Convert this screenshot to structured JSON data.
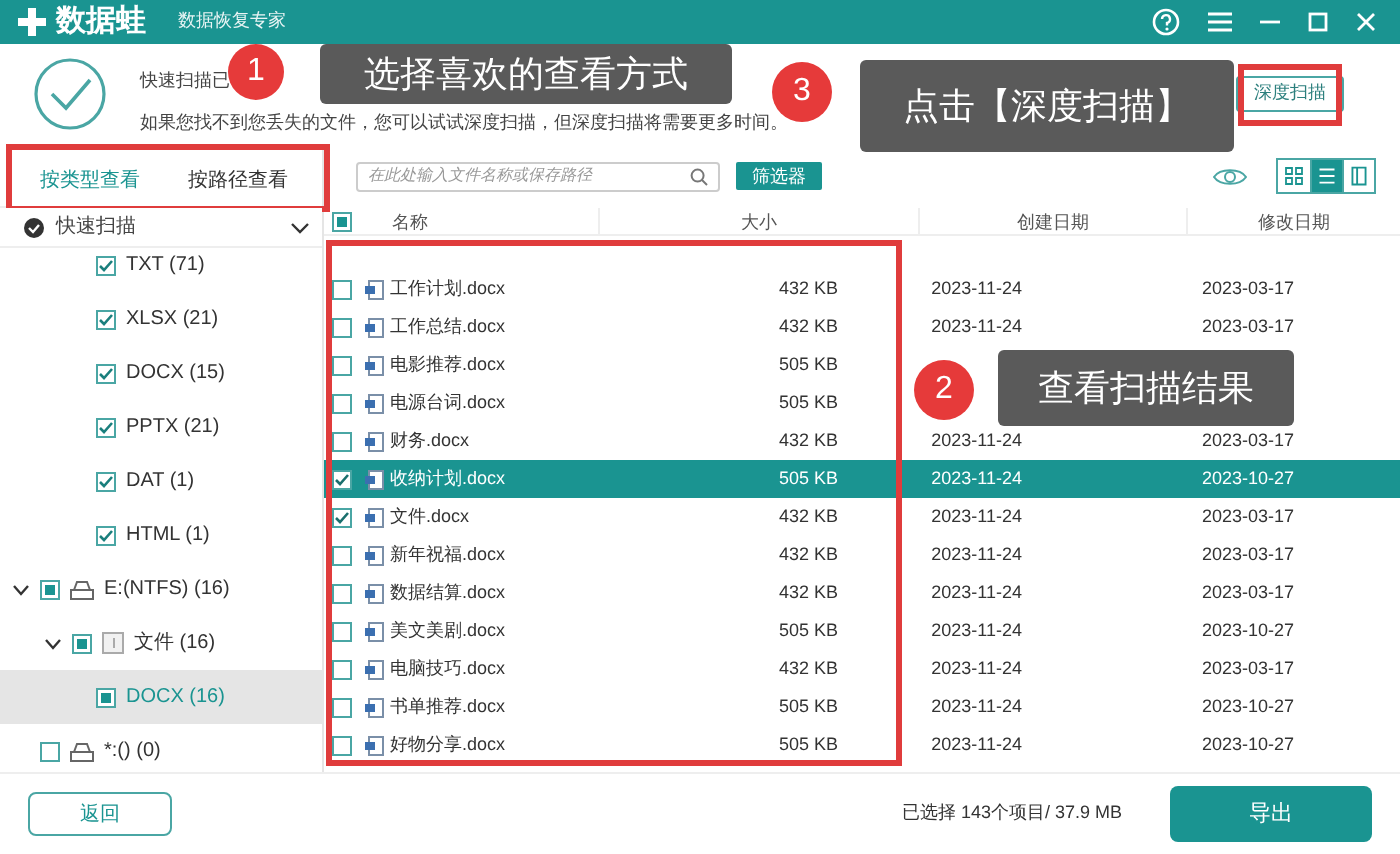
{
  "app": {
    "name": "数据蛙",
    "subtitle": "数据恢复专家"
  },
  "header": {
    "line_1": "快速扫描已",
    "line_2": "如果您找不到您丢失的文件，您可以试试深度扫描，但深度扫描将需要更多时间。",
    "deep_scan_button": "深度扫描"
  },
  "view_tabs": [
    {
      "label": "按类型查看",
      "selected": true
    },
    {
      "label": "按路径查看",
      "selected": false
    }
  ],
  "search": {
    "placeholder": "在此处输入文件名称或保存路径"
  },
  "filter_button": "筛选器",
  "view_modes": [
    {
      "kind": "grid",
      "selected": false
    },
    {
      "kind": "list",
      "selected": true
    },
    {
      "kind": "panel",
      "selected": false
    }
  ],
  "tree_header": "快速扫描",
  "tree": [
    {
      "label": "TXT (71)",
      "kind": "type",
      "checked": true,
      "partial": false,
      "selected": false,
      "expanded": false
    },
    {
      "label": "XLSX (21)",
      "kind": "type",
      "checked": true,
      "partial": false,
      "selected": false,
      "expanded": false
    },
    {
      "label": "DOCX (15)",
      "kind": "type",
      "checked": true,
      "partial": false,
      "selected": false,
      "expanded": false
    },
    {
      "label": "PPTX (21)",
      "kind": "type",
      "checked": true,
      "partial": false,
      "selected": false,
      "expanded": false
    },
    {
      "label": "DAT (1)",
      "kind": "type",
      "checked": true,
      "partial": false,
      "selected": false,
      "expanded": false
    },
    {
      "label": "HTML (1)",
      "kind": "type",
      "checked": true,
      "partial": false,
      "selected": false,
      "expanded": false
    },
    {
      "label": "E:(NTFS) (16)",
      "kind": "drive",
      "checked": false,
      "partial": true,
      "selected": false,
      "expanded": true,
      "children": [
        {
          "label": "文件 (16)",
          "kind": "folder",
          "checked": false,
          "partial": true,
          "selected": false,
          "expanded": true,
          "children": [
            {
              "label": "DOCX (16)",
              "kind": "type",
              "checked": false,
              "partial": true,
              "selected": true,
              "expanded": false
            }
          ]
        }
      ]
    },
    {
      "label": "*:() (0)",
      "kind": "drive",
      "checked": false,
      "partial": false,
      "selected": false,
      "expanded": false
    }
  ],
  "table": {
    "columns": [
      "名称",
      "大小",
      "创建日期",
      "修改日期"
    ],
    "select_all": {
      "checked": false,
      "partial": true
    },
    "rows": [
      {
        "name": "工作计划.docx",
        "size": "432 KB",
        "created": "2023-11-24",
        "modified": "2023-03-17",
        "checked": false,
        "selected": false
      },
      {
        "name": "工作总结.docx",
        "size": "432 KB",
        "created": "2023-11-24",
        "modified": "2023-03-17",
        "checked": false,
        "selected": false
      },
      {
        "name": "电影推荐.docx",
        "size": "505 KB",
        "checked": false,
        "selected": false
      },
      {
        "name": "电源台词.docx",
        "size": "505 KB",
        "checked": false,
        "selected": false
      },
      {
        "name": "财务.docx",
        "size": "432 KB",
        "created": "2023-11-24",
        "modified": "2023-03-17",
        "checked": false,
        "selected": false
      },
      {
        "name": "收纳计划.docx",
        "size": "505 KB",
        "created": "2023-11-24",
        "modified": "2023-10-27",
        "checked": true,
        "selected": true
      },
      {
        "name": "文件.docx",
        "size": "432 KB",
        "created": "2023-11-24",
        "modified": "2023-03-17",
        "checked": true,
        "selected": false
      },
      {
        "name": "新年祝福.docx",
        "size": "432 KB",
        "created": "2023-11-24",
        "modified": "2023-03-17",
        "checked": false,
        "selected": false
      },
      {
        "name": "数据结算.docx",
        "size": "432 KB",
        "created": "2023-11-24",
        "modified": "2023-03-17",
        "checked": false,
        "selected": false
      },
      {
        "name": "美文美剧.docx",
        "size": "505 KB",
        "created": "2023-11-24",
        "modified": "2023-10-27",
        "checked": false,
        "selected": false
      },
      {
        "name": "电脑技巧.docx",
        "size": "432 KB",
        "created": "2023-11-24",
        "modified": "2023-03-17",
        "checked": false,
        "selected": false
      },
      {
        "name": "书单推荐.docx",
        "size": "505 KB",
        "created": "2023-11-24",
        "modified": "2023-10-27",
        "checked": false,
        "selected": false
      },
      {
        "name": "好物分享.docx",
        "size": "505 KB",
        "created": "2023-11-24",
        "modified": "2023-10-27",
        "checked": false,
        "selected": false
      }
    ]
  },
  "footer": {
    "back_button": "返回",
    "status": "已选择 143个项目/ 37.9 MB",
    "export_button": "导出"
  },
  "annotations": [
    {
      "number": "1",
      "text": "选择喜欢的查看方式"
    },
    {
      "number": "2",
      "text": "查看扫描结果"
    },
    {
      "number": "3",
      "text": "点击【深度扫描】"
    }
  ]
}
